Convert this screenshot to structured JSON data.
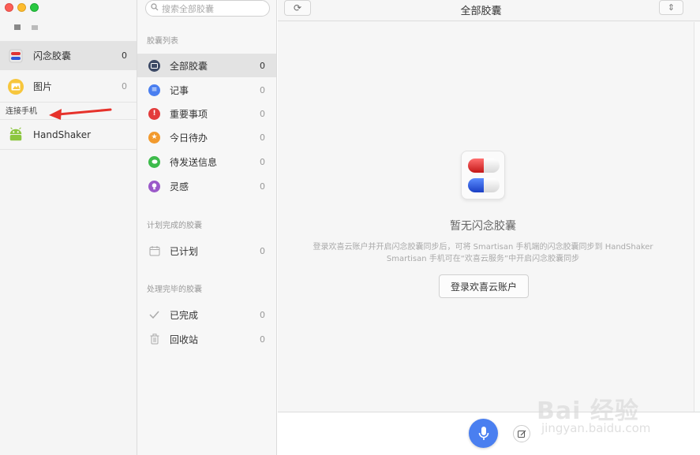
{
  "left_sidebar": {
    "items": [
      {
        "label": "闪念胶囊",
        "count": "0",
        "icon": "capsule-icon"
      },
      {
        "label": "图片",
        "count": "0",
        "icon": "photo-icon"
      }
    ],
    "section_phone": "连接手机",
    "device": {
      "label": "HandShaker",
      "icon": "android-icon"
    }
  },
  "middle": {
    "search_placeholder": "搜索全部胶囊",
    "section_list": "胶囊列表",
    "items": [
      {
        "label": "全部胶囊",
        "count": "0",
        "color": "#3d4a66"
      },
      {
        "label": "记事",
        "count": "0",
        "color": "#4a7ff0"
      },
      {
        "label": "重要事项",
        "count": "0",
        "color": "#e33b3b"
      },
      {
        "label": "今日待办",
        "count": "0",
        "color": "#f29a2e"
      },
      {
        "label": "待发送信息",
        "count": "0",
        "color": "#3dbb4b"
      },
      {
        "label": "灵感",
        "count": "0",
        "color": "#9b59c9"
      }
    ],
    "section_planned": "计划完成的胶囊",
    "planned": {
      "label": "已计划",
      "count": "0"
    },
    "section_done": "处理完毕的胶囊",
    "done_items": [
      {
        "label": "已完成",
        "count": "0"
      },
      {
        "label": "回收站",
        "count": "0"
      }
    ]
  },
  "main": {
    "title": "全部胶囊",
    "empty_title": "暂无闪念胶囊",
    "empty_desc_line1": "登录欢喜云账户并开启闪念胶囊同步后，可将 Smartisan 手机端的闪念胶囊同步到 HandShaker",
    "empty_desc_line2": "Smartisan 手机可在“欢喜云服务”中开启闪念胶囊同步",
    "login_button": "登录欢喜云账户"
  },
  "watermark": {
    "brand": "Bai 经验",
    "url": "jingyan.baidu.com"
  }
}
